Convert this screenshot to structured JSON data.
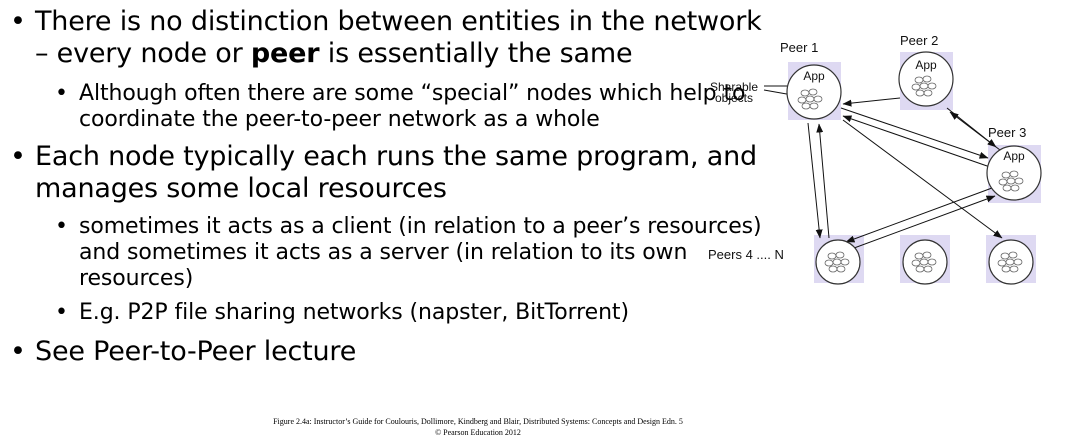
{
  "bullets": {
    "p1": {
      "before": "There is no distinction between entities in the network – every node or ",
      "strong": "peer",
      "after": " is essentially the same"
    },
    "p1_sub1": "Although often there are some “special” nodes which help to coordinate the peer-to-peer network as a whole",
    "p2": "Each node typically each runs the same program, and manages some local resources",
    "p2_sub1": "sometimes it acts as a client (in relation to a peer’s resources) and sometimes it acts as a server (in relation to its own resources)",
    "p2_sub2": "E.g. P2P file sharing networks (napster, BitTorrent)",
    "p3": "See Peer-to-Peer lecture"
  },
  "bullet_glyph": "•",
  "diagram": {
    "peer1": "Peer 1",
    "peer2": "Peer 2",
    "peer3": "Peer 3",
    "peers4n": "Peers 4 .... N",
    "app": "App",
    "sharable_1": "Sharable",
    "sharable_2": "objects"
  },
  "footer": {
    "line1": "Figure 2.4a: Instructor’s Guide for  Coulouris, Dollimore, Kindberg and Blair,  Distributed Systems: Concepts and Design   Edn. 5",
    "line2": "©  Pearson Education 2012"
  }
}
